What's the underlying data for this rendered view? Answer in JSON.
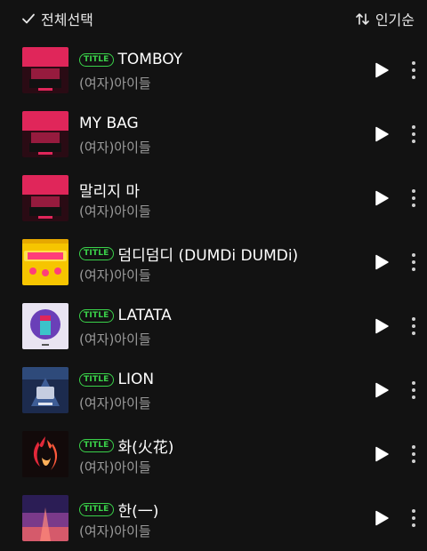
{
  "header": {
    "select_all_label": "전체선택",
    "sort_label": "인기순",
    "check_icon": "check-icon",
    "sort_icon": "sort-arrows-icon"
  },
  "badge_text": "TITLE",
  "colors": {
    "background": "#121212",
    "badge_green": "#3ad24a",
    "artist_grey": "#9a9a9a"
  },
  "songs": [
    {
      "title": "TOMBOY",
      "artist": "(여자)아이들",
      "is_title": true,
      "cover": "pink-dark"
    },
    {
      "title": "MY BAG",
      "artist": "(여자)아이들",
      "is_title": false,
      "cover": "pink-dark"
    },
    {
      "title": "말리지 마",
      "artist": "(여자)아이들",
      "is_title": false,
      "cover": "pink-dark"
    },
    {
      "title": "덤디덤디 (DUMDi DUMDi)",
      "artist": "(여자)아이들",
      "is_title": true,
      "cover": "yellow"
    },
    {
      "title": "LATATA",
      "artist": "(여자)아이들",
      "is_title": true,
      "cover": "purple"
    },
    {
      "title": "LION",
      "artist": "(여자)아이들",
      "is_title": true,
      "cover": "navy"
    },
    {
      "title": "화(火花)",
      "artist": "(여자)아이들",
      "is_title": true,
      "cover": "fire"
    },
    {
      "title": "한(一)",
      "artist": "(여자)아이들",
      "is_title": true,
      "cover": "sunset"
    }
  ]
}
